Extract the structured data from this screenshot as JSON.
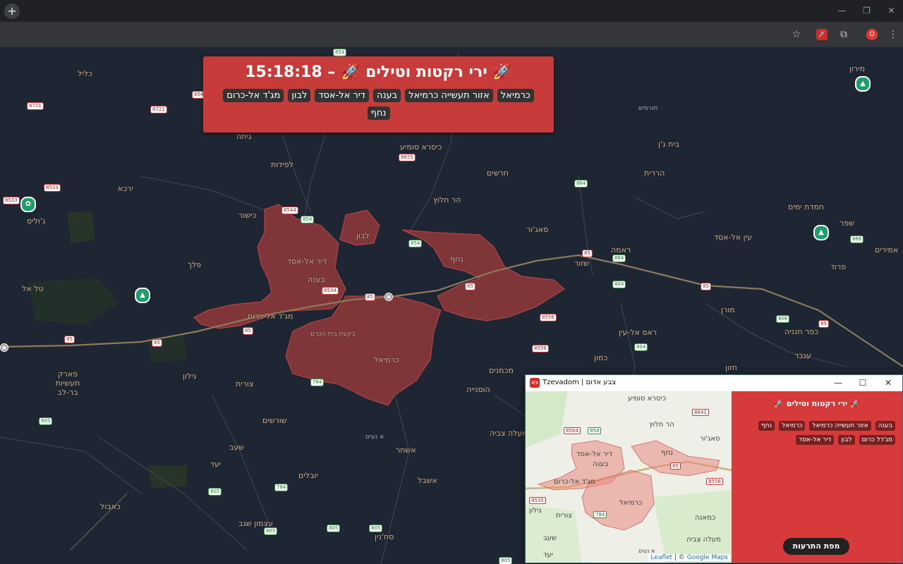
{
  "browser": {
    "new_tab_symbol": "+",
    "window_controls": [
      "—",
      "❐",
      "✕"
    ],
    "extension_badge": "O"
  },
  "map_labels": {
    "kalil": "כליל",
    "gita": "גיתה",
    "lapidot": "לפידות",
    "yirka": "ירכא",
    "julis": "ג'וליס",
    "kishor": "כישור",
    "pelekh": "פלך",
    "tel_el": "טל אל",
    "kisra": "כיסרא סומיע",
    "harashim": "חרשים",
    "har_halutz": "הר חלוץ",
    "lavon": "לבון",
    "deir_al_asad": "דיר אל-אסד",
    "bina": "בענה",
    "majd": "מג'ד אל-כרום",
    "karmiel": "כרמיאל",
    "nahf": "נחף",
    "sajur": "סאג'ור",
    "rama": "ראמה",
    "shezor": "שזור",
    "ein_al_asad": "עין אל-אסד",
    "hamadat": "חמדת ימים",
    "shefer": "שפר",
    "parod": "פרוד",
    "amirim": "אמירים",
    "moran": "מורן",
    "ras_al_ein": "ראס אל-עין",
    "kfar_hanania": "כפר חנניה",
    "kamon": "כמון",
    "michmanim": "מכמנים",
    "husniya": "הוסנייה",
    "hazon": "חזון",
    "kamana": "כמאנה",
    "eyal": "עגבר",
    "gilon": "גילון",
    "tzurit": "צורית",
    "shoresh": "שורשים",
    "shaav": "שעב",
    "yaad": "יעד",
    "yuvalim": "יובלים",
    "eshbal": "אשבל",
    "ashhar": "אשחר",
    "maale_tzvia": "מעלה צביה",
    "kaabiyye": "כאבול",
    "atzmon": "עצמון שגב",
    "sachnin": "סח'נין",
    "bar_lev": "פארק תעשיות בר-לב",
    "meron": "מירון",
    "beit_jann": "בית ג'ן",
    "horfeish": "חורפיש",
    "hararit": "הררית",
    "eilabun": "א נעים",
    "beit_hakerem": "בקעת בית הכרם"
  },
  "alert": {
    "time": "15:18:18",
    "title": "ירי רקטות וטילים",
    "separator": "–",
    "icon": "🚀",
    "areas": [
      "כרמיאל",
      "אזור תעשייה כרמיאל",
      "בענה",
      "דיר אל-אסד",
      "לבון",
      "מג'ד אל-כרום",
      "נחף"
    ]
  },
  "popup": {
    "window_title": "Tzevadom | צבע אדום",
    "app_icon": "צא",
    "controls": [
      "—",
      "☐",
      "✕"
    ],
    "alert_title": "ירי רקטות וטילים",
    "areas": [
      "בענה",
      "אזור תעשייה כרמיאל",
      "כרמיאל",
      "נחף",
      "מג'דל כרום",
      "לבון",
      "דיר אל-אסד"
    ],
    "map_button": "מפת התרעות",
    "attribution_leaflet": "Leaflet",
    "attribution_sep": " | © ",
    "attribution_google": "Google Maps",
    "mini_labels": {
      "kisra": "כיסרא סומיע",
      "har_halutz": "הר חלוץ",
      "sajur": "סאג'ור",
      "deir": "דיר אל-אסד",
      "bina": "בענה",
      "nahf": "נחף",
      "majd": "מג'ד אל-כרום",
      "karmiel": "כרמיאל",
      "gilon": "גילון",
      "tzurit": "צורית",
      "kamana": "כמאנה",
      "maale": "מעלה צביה",
      "shaav": "שעב",
      "yaad": "יעד",
      "eilabun": "א נעים"
    }
  },
  "colors": {
    "map_bg": "#1f2633",
    "alert_zone": "#a23c3c",
    "alert_banner": "#c73b3b",
    "road": "#8c7a5c"
  }
}
